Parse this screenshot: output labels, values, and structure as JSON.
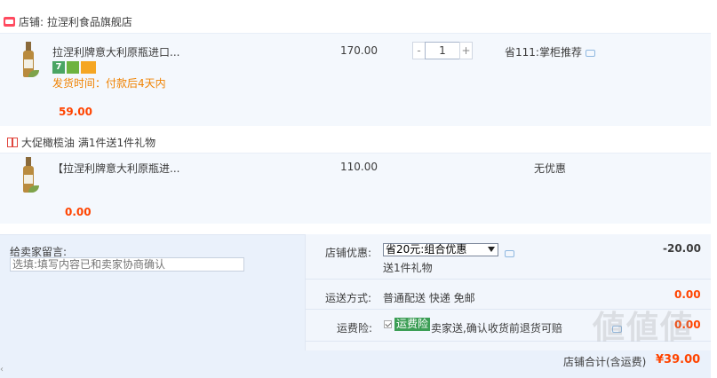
{
  "shop": {
    "name": "店铺: 拉涅利食品旗舰店"
  },
  "items": [
    {
      "title": "拉涅利牌意大利原瓶进口...",
      "badges": [
        "7",
        "",
        ""
      ],
      "ship_time": "发货时间：付款后4天内",
      "unit_price": "170.00",
      "quantity": "1",
      "promo": "省111:掌柜推荐",
      "subtotal": "59.00"
    },
    {
      "title": "【拉涅利牌意大利原瓶进...",
      "unit_price": "110.00",
      "promo": "无优惠",
      "subtotal": "0.00"
    }
  ],
  "gift_promo": "大促橄榄油   满1件送1件礼物",
  "qty_controls": {
    "minus": "-",
    "plus": "+"
  },
  "message": {
    "label": "给卖家留言:",
    "placeholder": "选填:填写内容已和卖家协商确认"
  },
  "discount": {
    "label": "店铺优惠:",
    "selected": "省20元:组合优惠",
    "gift": "送1件礼物",
    "amount": "-20.00"
  },
  "shipping": {
    "label": "运送方式:",
    "method": "普通配送 快递 免邮",
    "amount": "0.00"
  },
  "insurance": {
    "label": "运费险:",
    "tag": "运费险",
    "desc": "卖家送,确认收货前退货可赔",
    "amount": "0.00"
  },
  "total": {
    "label": "店铺合计(含运费)",
    "value": "¥39.00"
  },
  "watermark": "値値値",
  "colors": {
    "accent": "#ff4400",
    "ship": "#f08200",
    "panel": "#f4f8fd",
    "insurance_tag": "#3c9e55"
  }
}
